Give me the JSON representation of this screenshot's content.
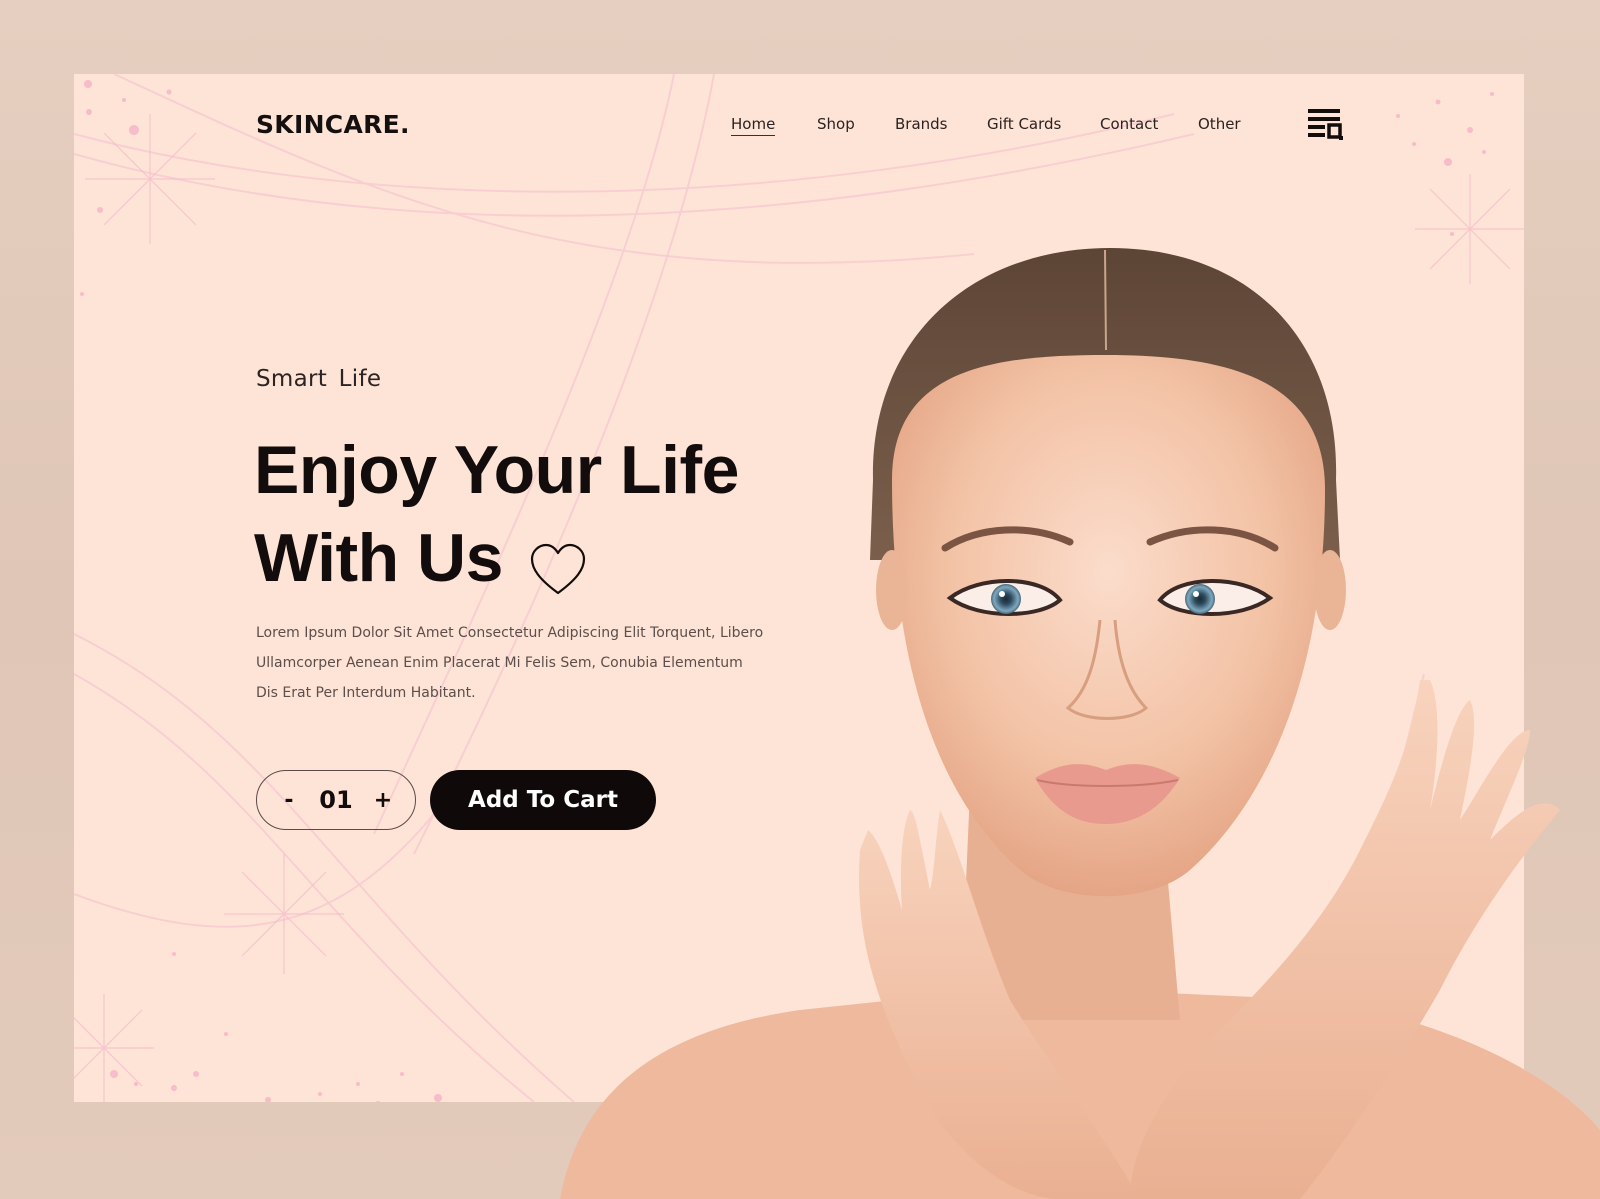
{
  "brand": {
    "logo": "SKINCARE."
  },
  "nav": {
    "items": [
      {
        "label": "Home",
        "active": true
      },
      {
        "label": "Shop",
        "active": false
      },
      {
        "label": "Brands",
        "active": false
      },
      {
        "label": "Gift Cards",
        "active": false
      },
      {
        "label": "Contact",
        "active": false
      },
      {
        "label": "Other",
        "active": false
      }
    ],
    "menu_icon": "menu-search-icon"
  },
  "hero": {
    "tagline": "Smart  Life",
    "headline_line1": "Enjoy Your Life",
    "headline_line2": "With Us",
    "headline_icon": "heart-outline-icon",
    "description": "Lorem Ipsum Dolor Sit Amet Consectetur Adipiscing Elit Torquent, Libero Ullamcorper Aenean Enim Placerat Mi Felis Sem, Conubia Elementum Dis Erat Per Interdum Habitant.",
    "quantity": {
      "minus_label": "-",
      "value": "01",
      "plus_label": "+"
    },
    "cta_label": "Add To Cart",
    "image_subject": "woman-face-with-hands-photo"
  },
  "colors": {
    "page_bg": "#e3cbbb",
    "card_bg": "#fee4d6",
    "text_dark": "#120c0c",
    "button_bg": "#0f0909",
    "button_text": "#ffffff",
    "accent_pink": "#f7bfd0"
  }
}
